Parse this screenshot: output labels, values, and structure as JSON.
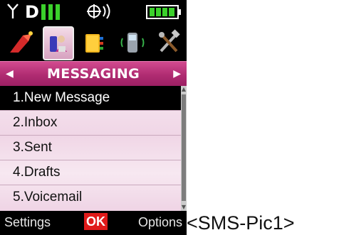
{
  "status": {
    "carrier": "D",
    "battery_color": "#3bd12b",
    "signal_color": "#3bd12b"
  },
  "app_icons": [
    "games-icon",
    "contacts-icon",
    "phonebook-icon",
    "phone-icon",
    "settings-tools-icon"
  ],
  "menu": {
    "title": "MESSAGING",
    "items": [
      "1.New Message",
      "2.Inbox",
      "3.Sent",
      "4.Drafts",
      "5.Voicemail"
    ],
    "selected_index": 0
  },
  "softkeys": {
    "left": "Settings",
    "center": "OK",
    "right": "Options"
  },
  "caption": "<SMS-Pic1>",
  "colors": {
    "title_bar": "#b02c72",
    "ok_key": "#e01a1a",
    "list_bg": "#f3deeb"
  }
}
